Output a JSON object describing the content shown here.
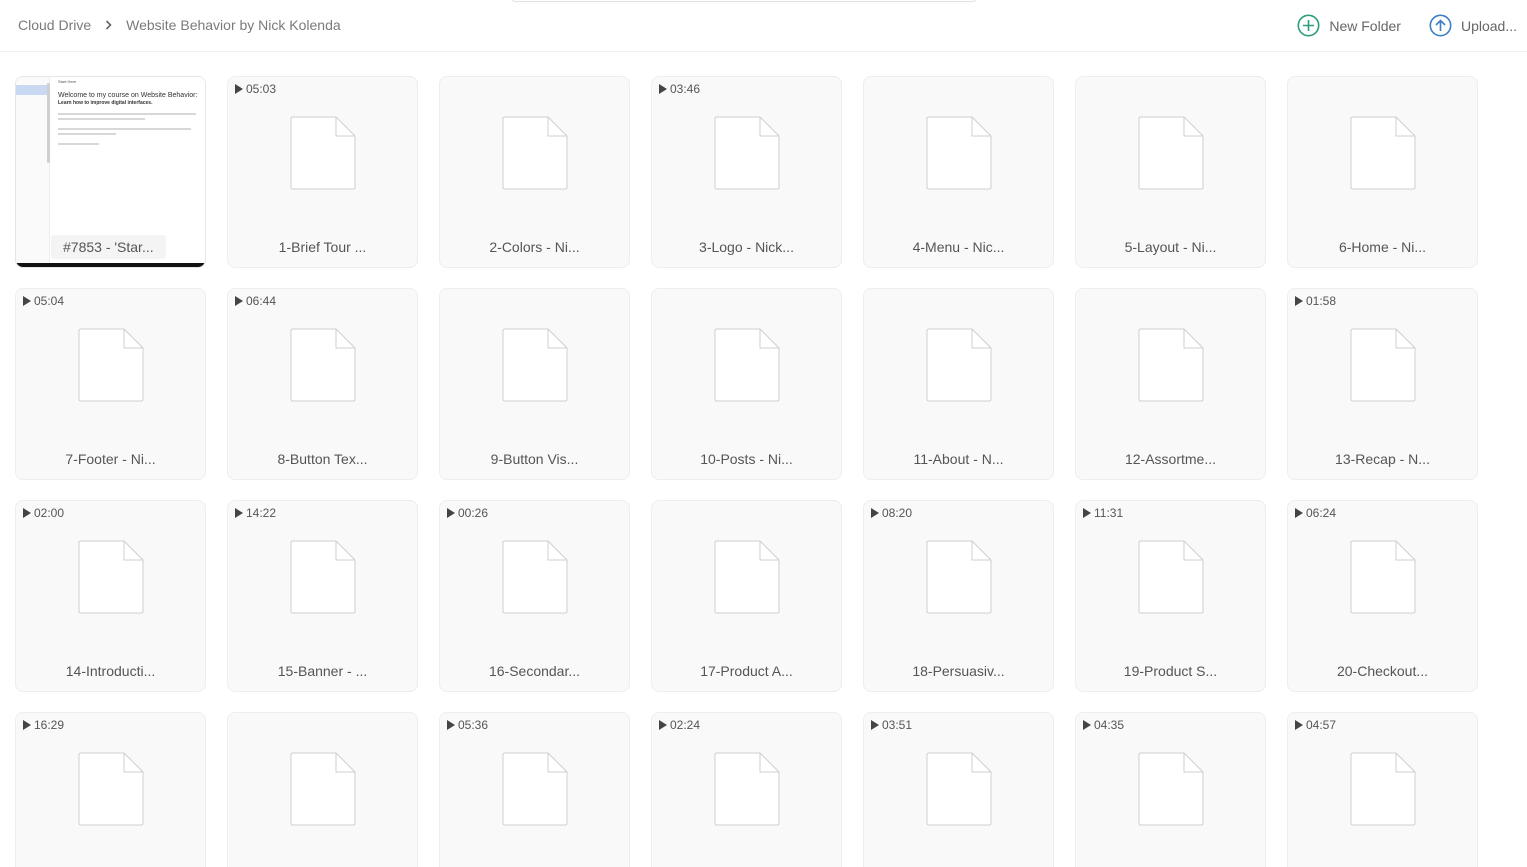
{
  "breadcrumb": {
    "root": "Cloud Drive",
    "current": "Website Behavior by Nick Kolenda"
  },
  "actions": {
    "new_folder": "New Folder",
    "upload": "Upload..."
  },
  "colors": {
    "accent": "#2a9d7a",
    "tile_bg": "#f9f9f9"
  },
  "preview": {
    "crumb": "Start Here",
    "title": "Welcome to my course on Website Behavior:",
    "subtitle": "Learn how to improve digital interfaces."
  },
  "files": [
    {
      "name": "#7853 - 'Star...",
      "duration": "",
      "preview": true
    },
    {
      "name": "1-Brief Tour ...",
      "duration": "05:03"
    },
    {
      "name": "2-Colors - Ni...",
      "duration": ""
    },
    {
      "name": "3-Logo - Nick...",
      "duration": "03:46"
    },
    {
      "name": "4-Menu - Nic...",
      "duration": ""
    },
    {
      "name": "5-Layout - Ni...",
      "duration": ""
    },
    {
      "name": "6-Home - Ni...",
      "duration": ""
    },
    {
      "name": "7-Footer - Ni...",
      "duration": "05:04"
    },
    {
      "name": "8-Button Tex...",
      "duration": "06:44"
    },
    {
      "name": "9-Button Vis...",
      "duration": ""
    },
    {
      "name": "10-Posts - Ni...",
      "duration": ""
    },
    {
      "name": "11-About - N...",
      "duration": ""
    },
    {
      "name": "12-Assortme...",
      "duration": ""
    },
    {
      "name": "13-Recap - N...",
      "duration": "01:58"
    },
    {
      "name": "14-Introducti...",
      "duration": "02:00"
    },
    {
      "name": "15-Banner - ...",
      "duration": "14:22"
    },
    {
      "name": "16-Secondar...",
      "duration": "00:26"
    },
    {
      "name": "17-Product A...",
      "duration": ""
    },
    {
      "name": "18-Persuasiv...",
      "duration": "08:20"
    },
    {
      "name": "19-Product S...",
      "duration": "11:31"
    },
    {
      "name": "20-Checkout...",
      "duration": "06:24"
    },
    {
      "name": "",
      "duration": "16:29"
    },
    {
      "name": "",
      "duration": ""
    },
    {
      "name": "",
      "duration": "05:36"
    },
    {
      "name": "",
      "duration": "02:24"
    },
    {
      "name": "",
      "duration": "03:51"
    },
    {
      "name": "",
      "duration": "04:35"
    },
    {
      "name": "",
      "duration": "04:57"
    }
  ]
}
